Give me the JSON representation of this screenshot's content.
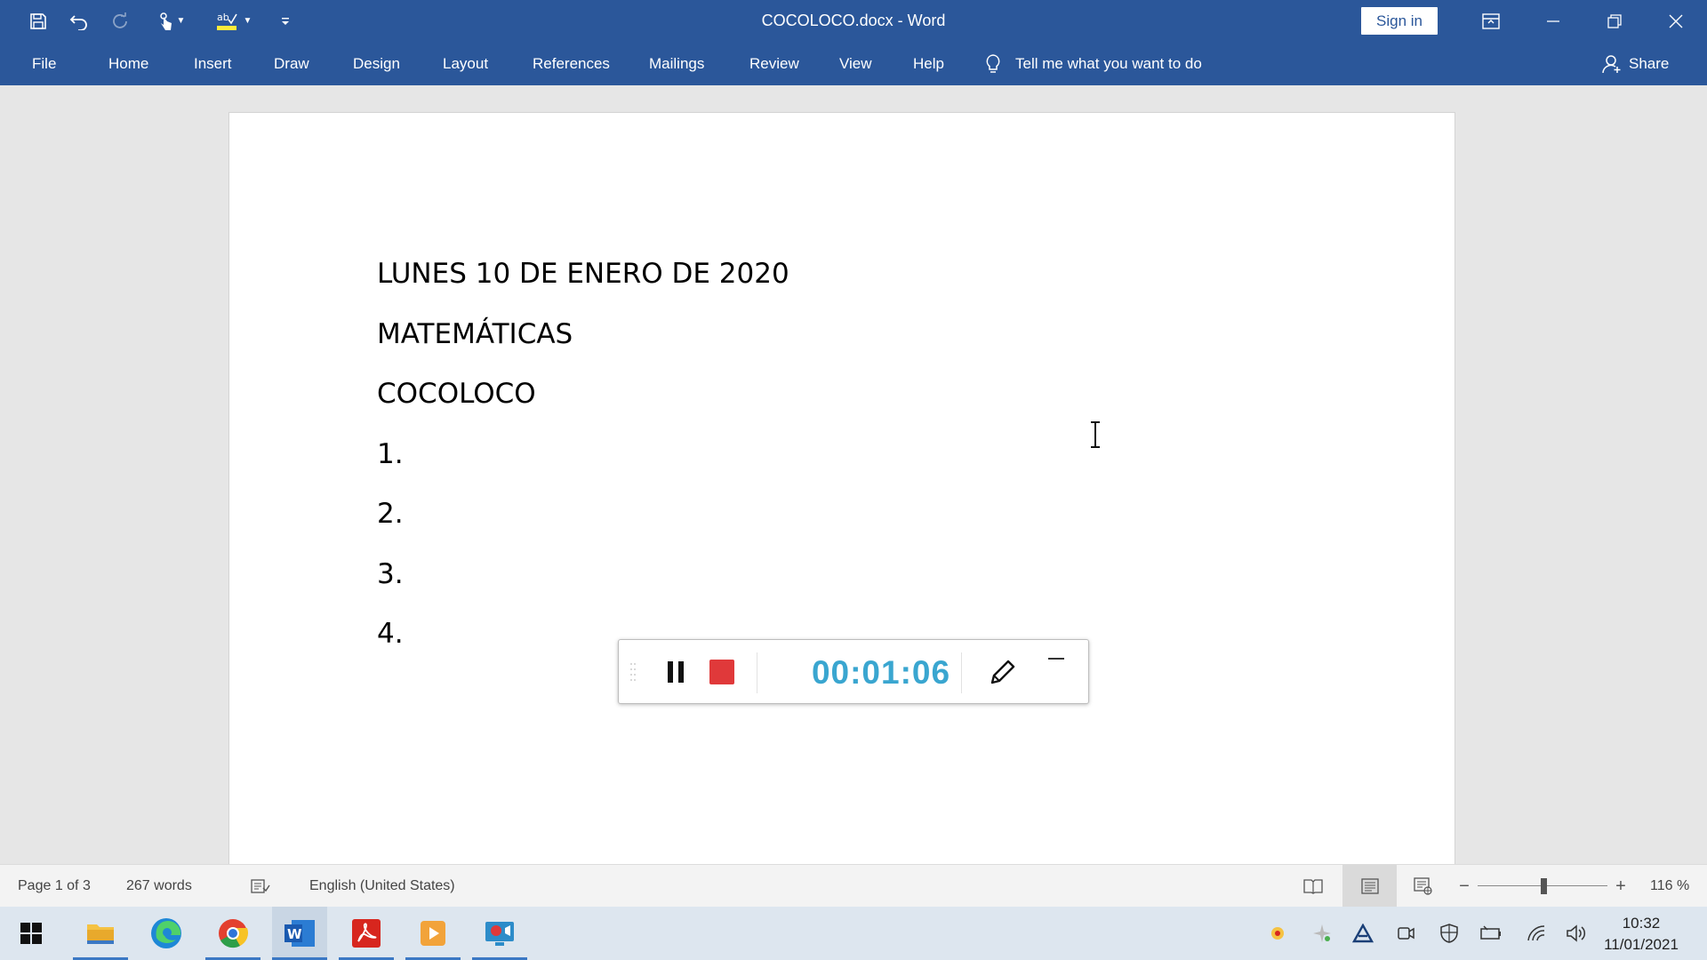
{
  "window": {
    "title": "COCOLOCO.docx  -  Word",
    "sign_in_label": "Sign in"
  },
  "ribbon": {
    "tabs": [
      {
        "label": "File"
      },
      {
        "label": "Home"
      },
      {
        "label": "Insert"
      },
      {
        "label": "Draw"
      },
      {
        "label": "Design"
      },
      {
        "label": "Layout"
      },
      {
        "label": "References"
      },
      {
        "label": "Mailings"
      },
      {
        "label": "Review"
      },
      {
        "label": "View"
      },
      {
        "label": "Help"
      }
    ],
    "tell_me": "Tell me what you want to do",
    "share": "Share"
  },
  "document": {
    "lines": [
      "LUNES 10 DE ENERO DE 2020",
      "MATEMÁTICAS",
      "COCOLOCO",
      "1.",
      "2.",
      "3.",
      "4."
    ]
  },
  "recorder": {
    "timer": "00:01:06",
    "stop_color": "#e0393a",
    "timer_color": "#3aa6d0"
  },
  "status": {
    "page": "Page 1 of 3",
    "words": "267 words",
    "language": "English (United States)",
    "zoom_minus": "−",
    "zoom_plus": "+",
    "zoom": "116 %"
  },
  "taskbar": {
    "time": "10:32",
    "date": "11/01/2021"
  },
  "colors": {
    "ribbon": "#2b579a",
    "taskbar": "#dde6ef"
  }
}
